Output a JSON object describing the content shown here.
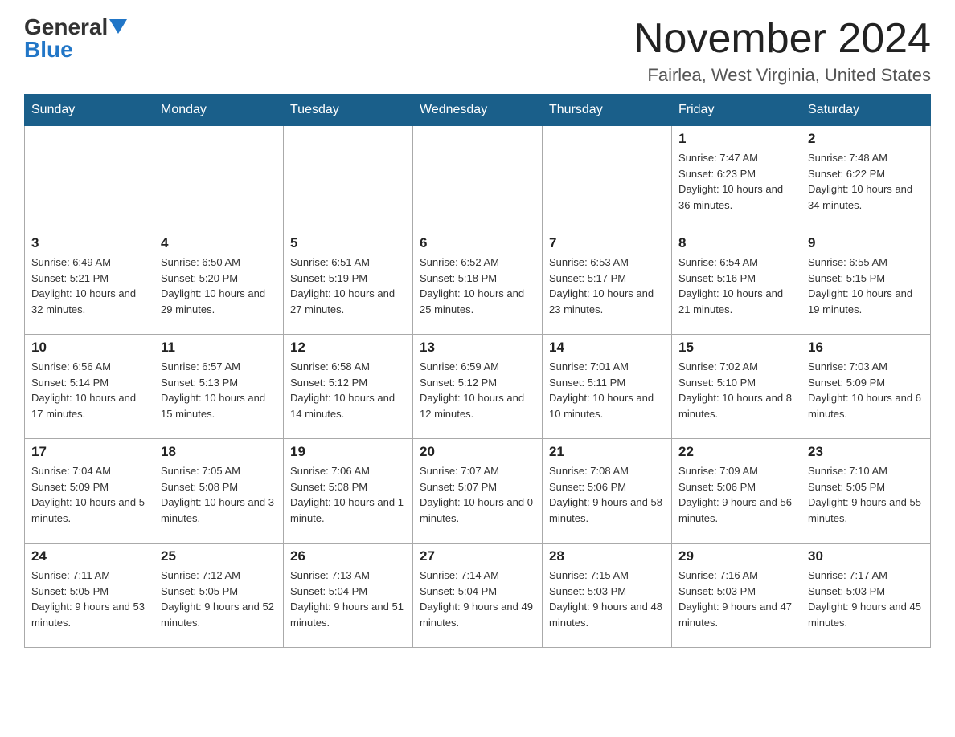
{
  "logo": {
    "general": "General",
    "blue": "Blue"
  },
  "title": "November 2024",
  "subtitle": "Fairlea, West Virginia, United States",
  "days_of_week": [
    "Sunday",
    "Monday",
    "Tuesday",
    "Wednesday",
    "Thursday",
    "Friday",
    "Saturday"
  ],
  "weeks": [
    [
      {
        "day": "",
        "info": ""
      },
      {
        "day": "",
        "info": ""
      },
      {
        "day": "",
        "info": ""
      },
      {
        "day": "",
        "info": ""
      },
      {
        "day": "",
        "info": ""
      },
      {
        "day": "1",
        "info": "Sunrise: 7:47 AM\nSunset: 6:23 PM\nDaylight: 10 hours and 36 minutes."
      },
      {
        "day": "2",
        "info": "Sunrise: 7:48 AM\nSunset: 6:22 PM\nDaylight: 10 hours and 34 minutes."
      }
    ],
    [
      {
        "day": "3",
        "info": "Sunrise: 6:49 AM\nSunset: 5:21 PM\nDaylight: 10 hours and 32 minutes."
      },
      {
        "day": "4",
        "info": "Sunrise: 6:50 AM\nSunset: 5:20 PM\nDaylight: 10 hours and 29 minutes."
      },
      {
        "day": "5",
        "info": "Sunrise: 6:51 AM\nSunset: 5:19 PM\nDaylight: 10 hours and 27 minutes."
      },
      {
        "day": "6",
        "info": "Sunrise: 6:52 AM\nSunset: 5:18 PM\nDaylight: 10 hours and 25 minutes."
      },
      {
        "day": "7",
        "info": "Sunrise: 6:53 AM\nSunset: 5:17 PM\nDaylight: 10 hours and 23 minutes."
      },
      {
        "day": "8",
        "info": "Sunrise: 6:54 AM\nSunset: 5:16 PM\nDaylight: 10 hours and 21 minutes."
      },
      {
        "day": "9",
        "info": "Sunrise: 6:55 AM\nSunset: 5:15 PM\nDaylight: 10 hours and 19 minutes."
      }
    ],
    [
      {
        "day": "10",
        "info": "Sunrise: 6:56 AM\nSunset: 5:14 PM\nDaylight: 10 hours and 17 minutes."
      },
      {
        "day": "11",
        "info": "Sunrise: 6:57 AM\nSunset: 5:13 PM\nDaylight: 10 hours and 15 minutes."
      },
      {
        "day": "12",
        "info": "Sunrise: 6:58 AM\nSunset: 5:12 PM\nDaylight: 10 hours and 14 minutes."
      },
      {
        "day": "13",
        "info": "Sunrise: 6:59 AM\nSunset: 5:12 PM\nDaylight: 10 hours and 12 minutes."
      },
      {
        "day": "14",
        "info": "Sunrise: 7:01 AM\nSunset: 5:11 PM\nDaylight: 10 hours and 10 minutes."
      },
      {
        "day": "15",
        "info": "Sunrise: 7:02 AM\nSunset: 5:10 PM\nDaylight: 10 hours and 8 minutes."
      },
      {
        "day": "16",
        "info": "Sunrise: 7:03 AM\nSunset: 5:09 PM\nDaylight: 10 hours and 6 minutes."
      }
    ],
    [
      {
        "day": "17",
        "info": "Sunrise: 7:04 AM\nSunset: 5:09 PM\nDaylight: 10 hours and 5 minutes."
      },
      {
        "day": "18",
        "info": "Sunrise: 7:05 AM\nSunset: 5:08 PM\nDaylight: 10 hours and 3 minutes."
      },
      {
        "day": "19",
        "info": "Sunrise: 7:06 AM\nSunset: 5:08 PM\nDaylight: 10 hours and 1 minute."
      },
      {
        "day": "20",
        "info": "Sunrise: 7:07 AM\nSunset: 5:07 PM\nDaylight: 10 hours and 0 minutes."
      },
      {
        "day": "21",
        "info": "Sunrise: 7:08 AM\nSunset: 5:06 PM\nDaylight: 9 hours and 58 minutes."
      },
      {
        "day": "22",
        "info": "Sunrise: 7:09 AM\nSunset: 5:06 PM\nDaylight: 9 hours and 56 minutes."
      },
      {
        "day": "23",
        "info": "Sunrise: 7:10 AM\nSunset: 5:05 PM\nDaylight: 9 hours and 55 minutes."
      }
    ],
    [
      {
        "day": "24",
        "info": "Sunrise: 7:11 AM\nSunset: 5:05 PM\nDaylight: 9 hours and 53 minutes."
      },
      {
        "day": "25",
        "info": "Sunrise: 7:12 AM\nSunset: 5:05 PM\nDaylight: 9 hours and 52 minutes."
      },
      {
        "day": "26",
        "info": "Sunrise: 7:13 AM\nSunset: 5:04 PM\nDaylight: 9 hours and 51 minutes."
      },
      {
        "day": "27",
        "info": "Sunrise: 7:14 AM\nSunset: 5:04 PM\nDaylight: 9 hours and 49 minutes."
      },
      {
        "day": "28",
        "info": "Sunrise: 7:15 AM\nSunset: 5:03 PM\nDaylight: 9 hours and 48 minutes."
      },
      {
        "day": "29",
        "info": "Sunrise: 7:16 AM\nSunset: 5:03 PM\nDaylight: 9 hours and 47 minutes."
      },
      {
        "day": "30",
        "info": "Sunrise: 7:17 AM\nSunset: 5:03 PM\nDaylight: 9 hours and 45 minutes."
      }
    ]
  ]
}
